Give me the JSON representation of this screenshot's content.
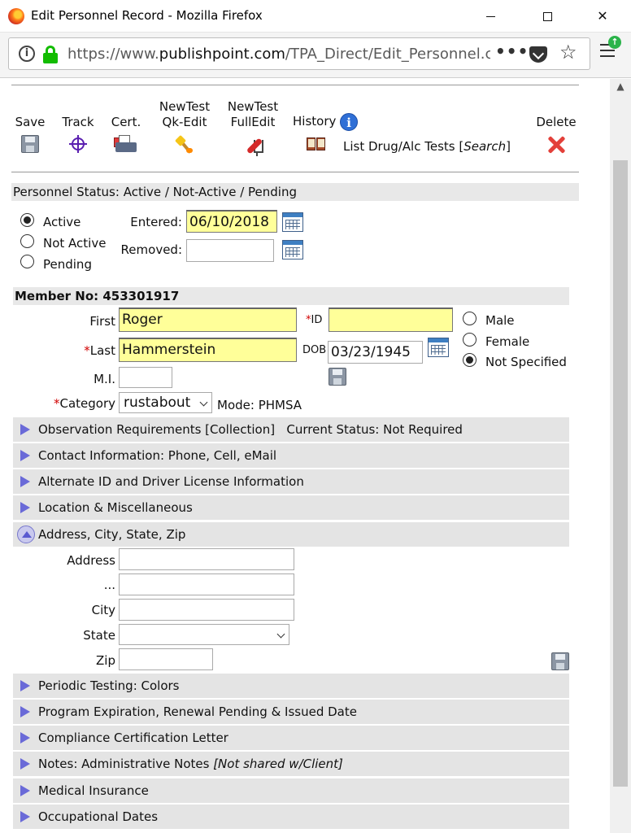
{
  "window": {
    "title": "Edit Personnel Record - Mozilla Firefox"
  },
  "browser": {
    "url_prefix": "https://www.",
    "url_host": "publishpoint.com",
    "url_path": "/TPA_Direct/Edit_Personnel.cfm"
  },
  "toolbar": {
    "save": "Save",
    "track": "Track",
    "cert": "Cert.",
    "newtest_qk_1": "NewTest",
    "newtest_qk_2": "Qk-Edit",
    "newtest_full_1": "NewTest",
    "newtest_full_2": "FullEdit",
    "history": "History",
    "list_tests": "List Drug/Alc Tests",
    "search": "Search",
    "delete": "Delete"
  },
  "status": {
    "header": "Personnel Status: Active / Not-Active / Pending",
    "options": [
      "Active",
      "Not Active",
      "Pending"
    ],
    "selected": "Active",
    "entered_label": "Entered:",
    "entered_value": "06/10/2018",
    "removed_label": "Removed:",
    "removed_value": ""
  },
  "member": {
    "header": "Member No: 453301917",
    "first_label": "First",
    "first_value": "Roger",
    "id_label": "ID",
    "id_value": "",
    "last_label": "Last",
    "last_value": "Hammerstein",
    "dob_label": "DOB",
    "dob_value": "03/23/1945",
    "mi_label": "M.I.",
    "mi_value": "",
    "category_label": "Category",
    "category_value": "rustabout",
    "mode_text": "Mode: PHMSA",
    "gender_options": [
      "Male",
      "Female",
      "Not Specified"
    ],
    "gender_selected": "Not Specified"
  },
  "sections": {
    "observation": "Observation Requirements [Collection]",
    "observation_status": "Current Status: Not Required",
    "contact": "Contact Information: Phone, Cell, eMail",
    "alternate_id": "Alternate ID and Driver License Information",
    "location": "Location & Miscellaneous",
    "address": "Address, City, State, Zip",
    "periodic": "Periodic Testing: Colors",
    "program": "Program Expiration, Renewal Pending & Issued Date",
    "compliance": "Compliance Certification Letter",
    "notes": "Notes: Administrative Notes",
    "notes_italic": "[Not shared w/Client]",
    "medical": "Medical Insurance",
    "occupational": "Occupational Dates"
  },
  "address": {
    "address_label": "Address",
    "address_value": "",
    "address2_label": "...",
    "address2_value": "",
    "city_label": "City",
    "city_value": "",
    "state_label": "State",
    "state_value": "",
    "zip_label": "Zip",
    "zip_value": ""
  },
  "colors": {
    "required_field": "#ffff99",
    "section_bar": "#e4e4e4",
    "accordion_arrow": "#6a6ad8",
    "required_star": "#d10000"
  }
}
